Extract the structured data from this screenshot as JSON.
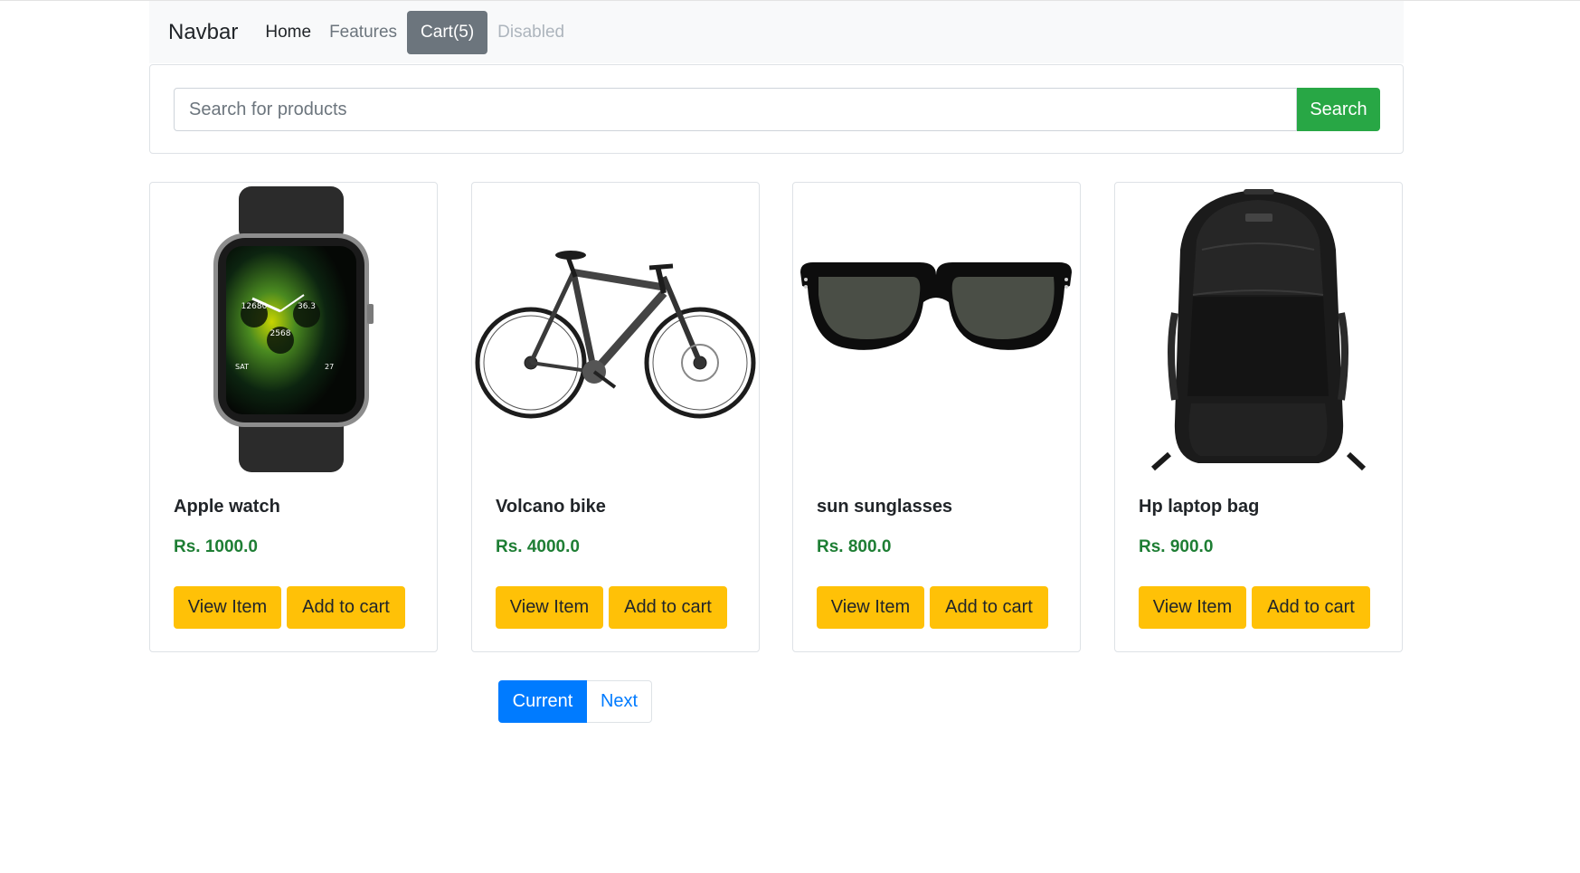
{
  "navbar": {
    "brand": "Navbar",
    "links": [
      {
        "label": "Home"
      },
      {
        "label": "Features"
      },
      {
        "label": "Cart(5)"
      },
      {
        "label": "Disabled"
      }
    ]
  },
  "search": {
    "placeholder": "Search for products",
    "value": "",
    "button_label": "Search"
  },
  "products": [
    {
      "name": "Apple watch",
      "price": "Rs. 1000.0",
      "image_icon": "smartwatch-image",
      "view_label": "View Item",
      "cart_label": "Add to cart"
    },
    {
      "name": "Volcano bike",
      "price": "Rs. 4000.0",
      "image_icon": "bicycle-image",
      "view_label": "View Item",
      "cart_label": "Add to cart"
    },
    {
      "name": "sun sunglasses",
      "price": "Rs. 800.0",
      "image_icon": "sunglasses-image",
      "view_label": "View Item",
      "cart_label": "Add to cart"
    },
    {
      "name": "Hp laptop bag",
      "price": "Rs. 900.0",
      "image_icon": "backpack-image",
      "view_label": "View Item",
      "cart_label": "Add to cart"
    }
  ],
  "watch_face": {
    "steps": "12680",
    "temp": "36.3",
    "heart": "2568",
    "day": "SAT",
    "date": "27"
  },
  "pagination": {
    "current_label": "Current",
    "next_label": "Next"
  },
  "colors": {
    "primary": "#007bff",
    "success": "#28a745",
    "warning": "#ffc107",
    "secondary": "#6c757d",
    "price": "#1e7e34"
  }
}
